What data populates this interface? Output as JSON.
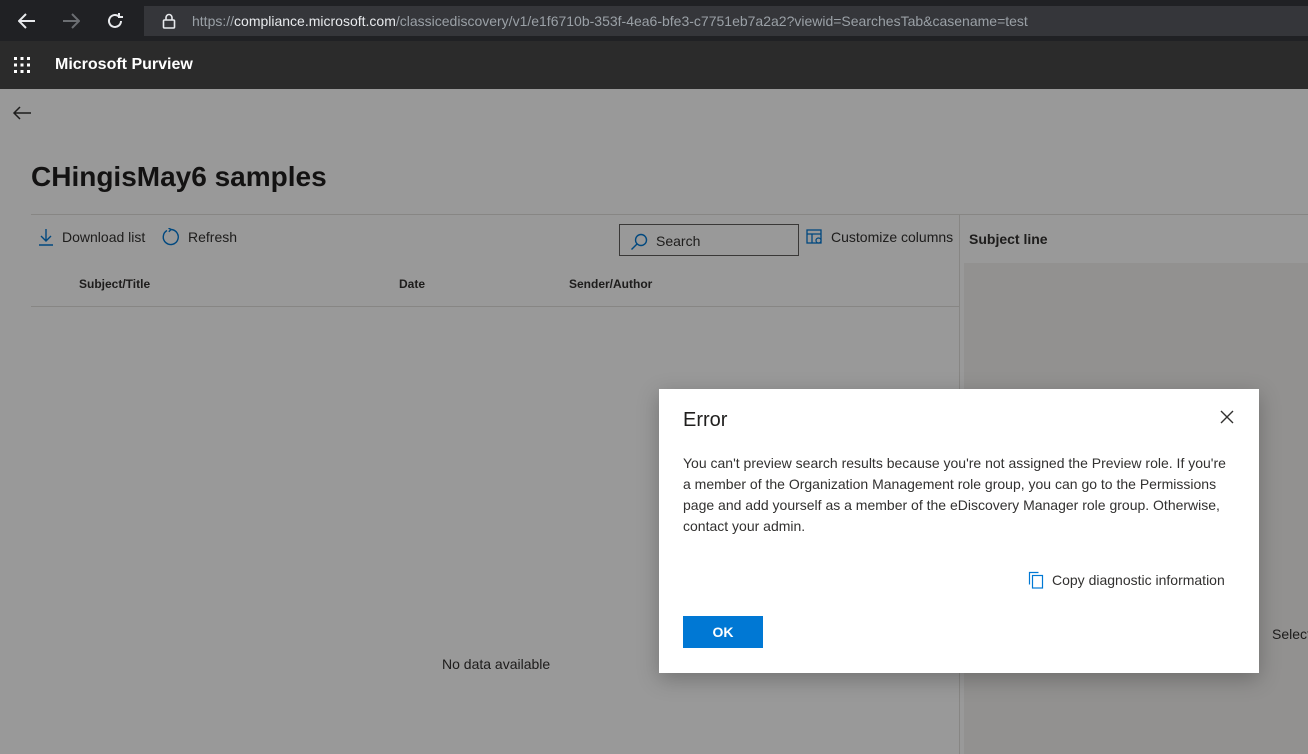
{
  "browser": {
    "url_prefix": "https://",
    "url_host": "compliance.microsoft.com",
    "url_path": "/classicediscovery/v1/e1f6710b-353f-4ea6-bfe3-c7751eb7a2a2?viewid=SearchesTab&casename=test"
  },
  "header": {
    "app_title": "Microsoft Purview"
  },
  "page": {
    "title": "CHingisMay6 samples",
    "toolbar": {
      "download_label": "Download list",
      "refresh_label": "Refresh",
      "search_placeholder": "Search",
      "customize_label": "Customize columns"
    },
    "columns": [
      "Subject/Title",
      "Date",
      "Sender/Author"
    ],
    "empty_text": "No data available",
    "preview": {
      "subject_label": "Subject line",
      "select_hint": "Select"
    }
  },
  "dialog": {
    "title": "Error",
    "body": "You can't preview search results because you're not assigned the Preview role. If you're a member of the Organization Management role group, you can go to the Permissions page and add yourself as a member of the eDiscovery Manager role group. Otherwise, contact your admin.",
    "copy_label": "Copy diagnostic information",
    "ok_label": "OK"
  },
  "colors": {
    "accent": "#0078d4",
    "header_bg": "#2b2b2b",
    "browser_bg": "#202124"
  },
  "icons": {
    "back": "arrow-left-icon",
    "forward": "arrow-right-icon",
    "reload": "reload-icon",
    "lock": "lock-icon",
    "waffle": "app-launcher-icon",
    "download": "download-icon",
    "refresh": "refresh-icon",
    "search": "search-icon",
    "customize": "customize-columns-icon",
    "close": "close-icon",
    "copy": "copy-icon"
  }
}
